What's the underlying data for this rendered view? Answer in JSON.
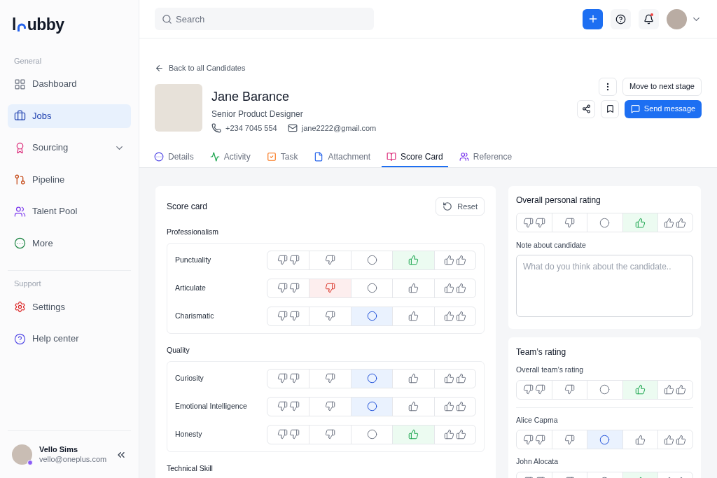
{
  "logo": {
    "before": "l",
    "after": "ubby"
  },
  "sidebar": {
    "sections": [
      {
        "title": "General",
        "items": [
          {
            "label": "Dashboard",
            "kind": "link",
            "selected": false
          },
          {
            "label": "Jobs",
            "kind": "link",
            "selected": true
          },
          {
            "label": "Sourcing",
            "kind": "group",
            "selected": false
          },
          {
            "label": "Pipeline",
            "kind": "link",
            "selected": false
          },
          {
            "label": "Talent Pool",
            "kind": "link",
            "selected": false
          },
          {
            "label": "More",
            "kind": "link",
            "selected": false
          }
        ]
      },
      {
        "title": "Support",
        "items": [
          {
            "label": "Settings",
            "kind": "link",
            "selected": false
          },
          {
            "label": "Help center",
            "kind": "link",
            "selected": false
          }
        ]
      }
    ],
    "user": {
      "name": "Vello Sims",
      "email": "vello@oneplus.com"
    }
  },
  "topbar": {
    "search": {
      "placeholder": "Search"
    },
    "has_notifications": true
  },
  "back_link": "Back to all Candidates",
  "candidate": {
    "name": "Jane Barance",
    "role": "Senior Product Designer",
    "phone": "+234 7045 554",
    "email": "jane2222@gmail.com"
  },
  "actions": {
    "next_stage": "Move to next stage",
    "send_message": "Send message"
  },
  "tabs": [
    {
      "label": "Details",
      "selected": false
    },
    {
      "label": "Activity",
      "selected": false
    },
    {
      "label": "Task",
      "selected": false
    },
    {
      "label": "Attachment",
      "selected": false
    },
    {
      "label": "Score Card",
      "selected": true
    },
    {
      "label": "Reference",
      "selected": false
    }
  ],
  "score_card": {
    "title": "Score card",
    "reset": "Reset",
    "groups": [
      {
        "title": "Professionalism",
        "rows": [
          {
            "label": "Punctuality",
            "options": [
              {
                "kind": "double_down",
                "selected": false
              },
              {
                "kind": "down",
                "selected": false
              },
              {
                "kind": "neutral",
                "selected": false
              },
              {
                "kind": "up",
                "selected": true
              },
              {
                "kind": "double_up",
                "selected": false
              }
            ]
          },
          {
            "label": "Articulate",
            "options": [
              {
                "kind": "double_down",
                "selected": false
              },
              {
                "kind": "down",
                "selected": true
              },
              {
                "kind": "neutral",
                "selected": false
              },
              {
                "kind": "up",
                "selected": false
              },
              {
                "kind": "double_up",
                "selected": false
              }
            ]
          },
          {
            "label": "Charismatic",
            "options": [
              {
                "kind": "double_down",
                "selected": false
              },
              {
                "kind": "down",
                "selected": false
              },
              {
                "kind": "neutral",
                "selected": true
              },
              {
                "kind": "up",
                "selected": false
              },
              {
                "kind": "double_up",
                "selected": false
              }
            ]
          }
        ]
      },
      {
        "title": "Quality",
        "rows": [
          {
            "label": "Curiosity",
            "options": [
              {
                "kind": "double_down",
                "selected": false
              },
              {
                "kind": "down",
                "selected": false
              },
              {
                "kind": "neutral",
                "selected": true
              },
              {
                "kind": "up",
                "selected": false
              },
              {
                "kind": "double_up",
                "selected": false
              }
            ]
          },
          {
            "label": "Emotional Intelligence",
            "options": [
              {
                "kind": "double_down",
                "selected": false
              },
              {
                "kind": "down",
                "selected": false
              },
              {
                "kind": "neutral",
                "selected": true
              },
              {
                "kind": "up",
                "selected": false
              },
              {
                "kind": "double_up",
                "selected": false
              }
            ]
          },
          {
            "label": "Honesty",
            "options": [
              {
                "kind": "double_down",
                "selected": false
              },
              {
                "kind": "down",
                "selected": false
              },
              {
                "kind": "neutral",
                "selected": false
              },
              {
                "kind": "up",
                "selected": true
              },
              {
                "kind": "double_up",
                "selected": false
              }
            ]
          }
        ]
      },
      {
        "title": "Technical Skill"
      }
    ]
  },
  "personal": {
    "title": "Overall personal rating",
    "options": [
      {
        "kind": "double_down",
        "selected": false
      },
      {
        "kind": "down",
        "selected": false
      },
      {
        "kind": "neutral",
        "selected": false
      },
      {
        "kind": "up",
        "selected": true
      },
      {
        "kind": "double_up",
        "selected": false
      }
    ],
    "note_label": "Note about candidate",
    "note": {
      "placeholder": "What do you think about the candidate.."
    }
  },
  "team": {
    "title": "Team’s rating",
    "overall_label": "Overall team’s rating",
    "overall_options": [
      {
        "kind": "double_down",
        "selected": false
      },
      {
        "kind": "down",
        "selected": false
      },
      {
        "kind": "neutral",
        "selected": false
      },
      {
        "kind": "up",
        "selected": true
      },
      {
        "kind": "double_up",
        "selected": false
      }
    ],
    "members": [
      {
        "name": "Alice Capma",
        "options": [
          {
            "kind": "double_down",
            "selected": false
          },
          {
            "kind": "down",
            "selected": false
          },
          {
            "kind": "neutral",
            "selected": true
          },
          {
            "kind": "up",
            "selected": false
          },
          {
            "kind": "double_up",
            "selected": false
          }
        ]
      },
      {
        "name": "John Alocata",
        "options": [
          {
            "kind": "double_down",
            "selected": false
          },
          {
            "kind": "down",
            "selected": false
          },
          {
            "kind": "neutral",
            "selected": false
          },
          {
            "kind": "up",
            "selected": true
          },
          {
            "kind": "double_up",
            "selected": false
          }
        ]
      }
    ]
  }
}
